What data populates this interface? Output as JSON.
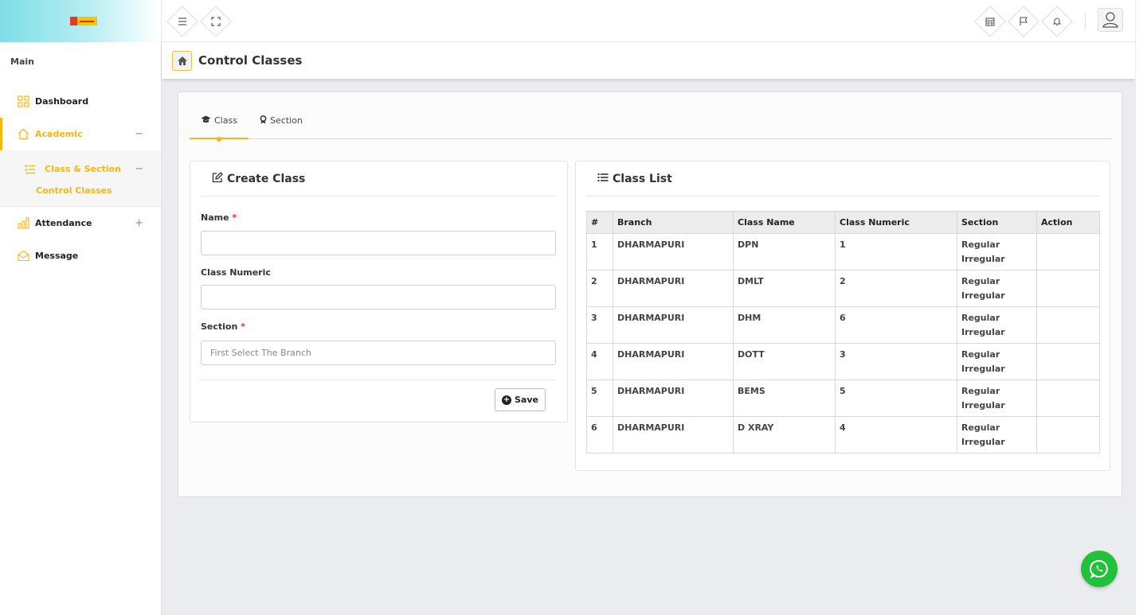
{
  "sidebar": {
    "section_label": "Main",
    "items": [
      {
        "label": "Dashboard",
        "icon": "grid-icon"
      },
      {
        "label": "Academic",
        "icon": "home-icon",
        "toggle": "−"
      },
      {
        "label": "Attendance",
        "icon": "bar-chart-icon",
        "toggle": "+"
      },
      {
        "label": "Message",
        "icon": "envelope-icon"
      }
    ],
    "sub_item": {
      "label": "Class & Section",
      "toggle": "−"
    },
    "sub_sub_item": {
      "label": "Control Classes"
    }
  },
  "topbar": {
    "left_icons": [
      "menu-icon",
      "fullscreen-icon"
    ],
    "right_icons": [
      "calendar-icon",
      "flag-icon",
      "bell-icon"
    ]
  },
  "page": {
    "title": "Control Classes"
  },
  "tabs": [
    {
      "label": "Class",
      "icon": "graduation-cap-icon",
      "active": true
    },
    {
      "label": "Section",
      "icon": "award-icon",
      "active": false
    }
  ],
  "create_form": {
    "heading": "Create Class",
    "name_label": "Name",
    "name_value": "",
    "numeric_label": "Class Numeric",
    "numeric_value": "",
    "section_label": "Section",
    "section_placeholder": "First Select The Branch",
    "required_mark": "*",
    "save_label": "Save"
  },
  "class_list": {
    "heading": "Class List",
    "columns": [
      "#",
      "Branch",
      "Class Name",
      "Class Numeric",
      "Section",
      "Action"
    ],
    "rows": [
      {
        "num": "1",
        "branch": "DHARMAPURI",
        "class_name": "DPN",
        "numeric": "1",
        "sections": [
          "Regular",
          "Irregular"
        ]
      },
      {
        "num": "2",
        "branch": "DHARMAPURI",
        "class_name": "DMLT",
        "numeric": "2",
        "sections": [
          "Regular",
          "Irregular"
        ]
      },
      {
        "num": "3",
        "branch": "DHARMAPURI",
        "class_name": "DHM",
        "numeric": "6",
        "sections": [
          "Regular",
          "Irregular"
        ]
      },
      {
        "num": "4",
        "branch": "DHARMAPURI",
        "class_name": "DOTT",
        "numeric": "3",
        "sections": [
          "Regular",
          "Irregular"
        ]
      },
      {
        "num": "5",
        "branch": "DHARMAPURI",
        "class_name": "BEMS",
        "numeric": "5",
        "sections": [
          "Regular",
          "Irregular"
        ]
      },
      {
        "num": "6",
        "branch": "DHARMAPURI",
        "class_name": "D XRAY",
        "numeric": "4",
        "sections": [
          "Regular",
          "Irregular"
        ]
      }
    ]
  },
  "colors": {
    "accent": "#f5b70b",
    "whatsapp": "#23c13a",
    "required": "#dd3333"
  }
}
